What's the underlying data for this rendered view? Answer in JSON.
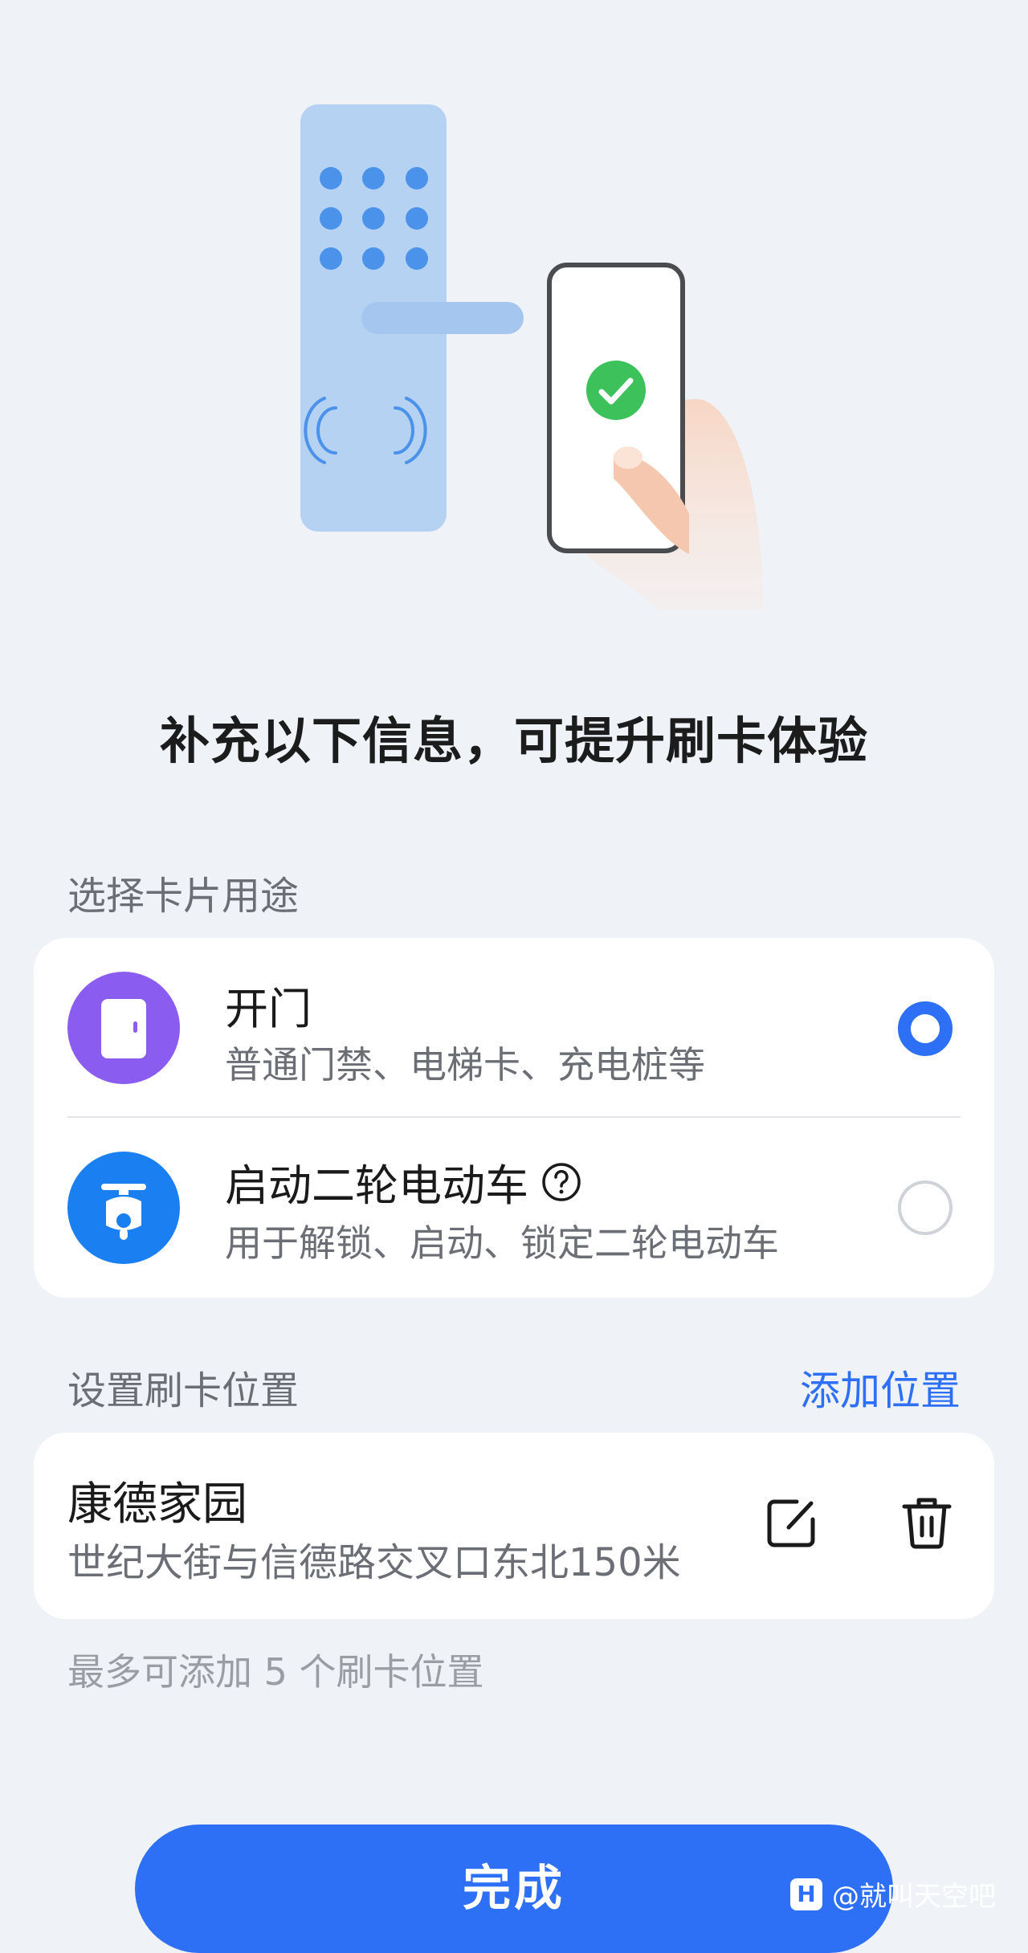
{
  "header": {
    "title": "补充以下信息，可提升刷卡体验"
  },
  "purpose": {
    "label": "选择卡片用途",
    "options": [
      {
        "title": "开门",
        "description": "普通门禁、电梯卡、充电桩等",
        "icon": "door-icon",
        "icon_color": "#8a5cf0",
        "selected": true
      },
      {
        "title": "启动二轮电动车",
        "description": "用于解锁、启动、锁定二轮电动车",
        "icon": "scooter-icon",
        "icon_color": "#1a7ff0",
        "selected": false
      }
    ]
  },
  "location": {
    "label": "设置刷卡位置",
    "add_label": "添加位置",
    "items": [
      {
        "name": "康德家园",
        "address": "世纪大街与信德路交叉口东北150米"
      }
    ],
    "hint": "最多可添加 5 个刷卡位置"
  },
  "footer": {
    "done_label": "完成"
  },
  "watermark": {
    "text": "@就叫天空吧"
  },
  "colors": {
    "accent": "#2d6ff5",
    "background": "#eff2f6",
    "success": "#3cc15b"
  }
}
